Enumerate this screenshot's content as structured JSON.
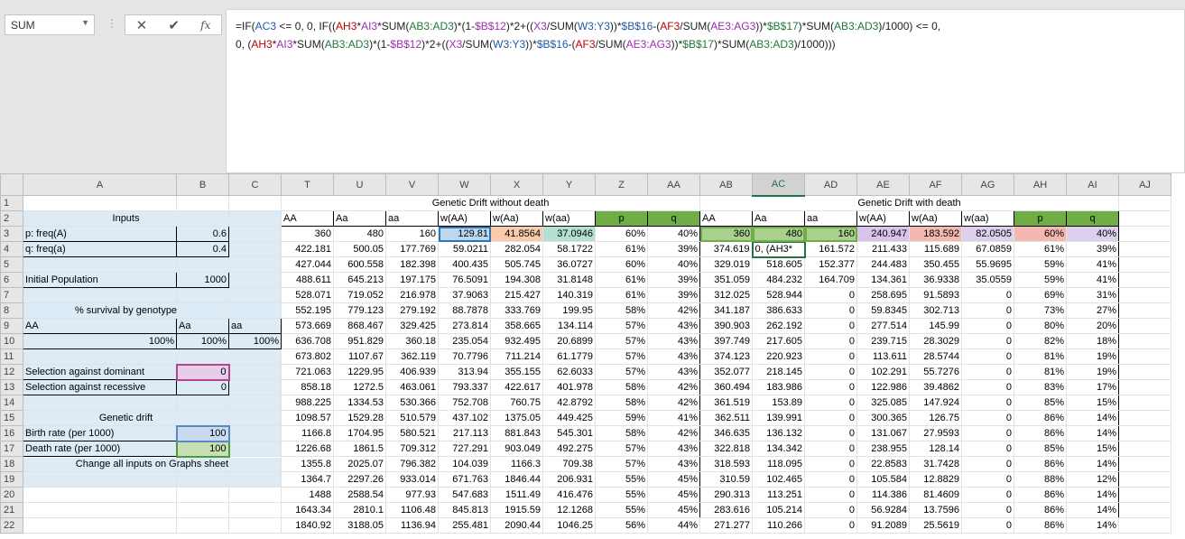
{
  "formula_bar": {
    "name_box": "SUM",
    "cancel_icon": "✕",
    "enter_icon": "✔",
    "fx_label": "fx",
    "line1_parts": [
      "=IF(",
      "AC3",
      " <= 0, 0, IF((",
      "AH3",
      "*",
      "AI3",
      "*SUM(",
      "AB3:AD3",
      ")*(1-",
      "$B$12",
      ")*2+((",
      "X3",
      "/SUM(",
      "W3:Y3",
      "))*",
      "$B$16",
      "-(",
      "AF3",
      "/SUM(",
      "AE3:AG3",
      "))*",
      "$B$17",
      ")*SUM(",
      "AB3:AD3",
      ")/1000) <= 0,"
    ],
    "line2_parts": [
      "0, (",
      "AH3",
      "*",
      "AI3",
      "*SUM(",
      "AB3:AD3",
      ")*(1-",
      "$B$12",
      ")*2+((",
      "X3",
      "/SUM(",
      "W3:Y3",
      "))*",
      "$B$16",
      "-(",
      "AF3",
      "/SUM(",
      "AE3:AG3",
      "))*",
      "$B$17",
      ")*SUM(",
      "AB3:AD3",
      ")/1000)))"
    ]
  },
  "columns": [
    "A",
    "B",
    "C",
    "T",
    "U",
    "V",
    "W",
    "X",
    "Y",
    "Z",
    "AA",
    "AB",
    "AC",
    "AD",
    "AE",
    "AF",
    "AG",
    "AH",
    "AI",
    "AJ"
  ],
  "selected_column": "AC",
  "inputs": {
    "title": "Inputs",
    "p_label": "p: freq(A)",
    "p_value": "0.6",
    "q_label": "q: freq(a)",
    "q_value": "0.4",
    "pop_label": "Initial Population",
    "pop_value": "1000",
    "survival_title": "% survival by genotype",
    "aa_dom_label": "AA",
    "aa_het_label": "Aa",
    "aa_rec_label": "aa",
    "surv_AA": "100%",
    "surv_Aa": "100%",
    "surv_aa": "100%",
    "sel_dom_label": "Selection against dominant",
    "sel_dom_value": "0",
    "sel_rec_label": "Selection against recessive",
    "sel_rec_value": "0",
    "drift_title": "Genetic drift",
    "birth_label": "Birth rate (per 1000)",
    "birth_value": "100",
    "death_label": "Death rate (per 1000)",
    "death_value": "100",
    "change_note": "Change all inputs on Graphs sheet"
  },
  "section_titles": {
    "without_death": "Genetic Drift without death",
    "with_death": "Genetic Drift with death"
  },
  "headers_without": [
    "AA",
    "Aa",
    "aa",
    "w(AA)",
    "w(Aa)",
    "w(aa)",
    "p",
    "q"
  ],
  "headers_with": [
    "AA",
    "Aa",
    "aa",
    "w(AA)",
    "w(Aa)",
    "w(aa)",
    "p",
    "q"
  ],
  "editing_text": "0, (AH3*",
  "rows_data": [
    [
      "360",
      "480",
      "160",
      "129.81",
      "41.8564",
      "37.0946",
      "60%",
      "40%",
      "360",
      "480",
      "160",
      "240.947",
      "183.592",
      "82.0505",
      "60%",
      "40%"
    ],
    [
      "422.181",
      "500.05",
      "177.769",
      "59.0211",
      "282.054",
      "58.1722",
      "61%",
      "39%",
      "374.619",
      "",
      "161.572",
      "211.433",
      "115.689",
      "67.0859",
      "61%",
      "39%"
    ],
    [
      "427.044",
      "600.558",
      "182.398",
      "400.435",
      "505.745",
      "36.0727",
      "60%",
      "40%",
      "329.019",
      "518.605",
      "152.377",
      "244.483",
      "350.455",
      "55.9695",
      "59%",
      "41%"
    ],
    [
      "488.611",
      "645.213",
      "197.175",
      "76.5091",
      "194.308",
      "31.8148",
      "61%",
      "39%",
      "351.059",
      "484.232",
      "164.709",
      "134.361",
      "36.9338",
      "35.0559",
      "59%",
      "41%"
    ],
    [
      "528.071",
      "719.052",
      "216.978",
      "37.9063",
      "215.427",
      "140.319",
      "61%",
      "39%",
      "312.025",
      "528.944",
      "0",
      "258.695",
      "91.5893",
      "0",
      "69%",
      "31%"
    ],
    [
      "552.195",
      "779.123",
      "279.192",
      "88.7878",
      "333.769",
      "199.95",
      "58%",
      "42%",
      "341.187",
      "386.633",
      "0",
      "59.8345",
      "302.713",
      "0",
      "73%",
      "27%"
    ],
    [
      "573.669",
      "868.467",
      "329.425",
      "273.814",
      "358.665",
      "134.114",
      "57%",
      "43%",
      "390.903",
      "262.192",
      "0",
      "277.514",
      "145.99",
      "0",
      "80%",
      "20%"
    ],
    [
      "636.708",
      "951.829",
      "360.18",
      "235.054",
      "932.495",
      "20.6899",
      "57%",
      "43%",
      "397.749",
      "217.605",
      "0",
      "239.715",
      "28.3029",
      "0",
      "82%",
      "18%"
    ],
    [
      "673.802",
      "1107.67",
      "362.119",
      "70.7796",
      "711.214",
      "61.1779",
      "57%",
      "43%",
      "374.123",
      "220.923",
      "0",
      "113.611",
      "28.5744",
      "0",
      "81%",
      "19%"
    ],
    [
      "721.063",
      "1229.95",
      "406.939",
      "313.94",
      "355.155",
      "62.6033",
      "57%",
      "43%",
      "352.077",
      "218.145",
      "0",
      "102.291",
      "55.7276",
      "0",
      "81%",
      "19%"
    ],
    [
      "858.18",
      "1272.5",
      "463.061",
      "793.337",
      "422.617",
      "401.978",
      "58%",
      "42%",
      "360.494",
      "183.986",
      "0",
      "122.986",
      "39.4862",
      "0",
      "83%",
      "17%"
    ],
    [
      "988.225",
      "1334.53",
      "530.366",
      "752.708",
      "760.75",
      "42.8792",
      "58%",
      "42%",
      "361.519",
      "153.89",
      "0",
      "325.085",
      "147.924",
      "0",
      "85%",
      "15%"
    ],
    [
      "1098.57",
      "1529.28",
      "510.579",
      "437.102",
      "1375.05",
      "449.425",
      "59%",
      "41%",
      "362.511",
      "139.991",
      "0",
      "300.365",
      "126.75",
      "0",
      "86%",
      "14%"
    ],
    [
      "1166.8",
      "1704.95",
      "580.521",
      "217.113",
      "881.843",
      "545.301",
      "58%",
      "42%",
      "346.635",
      "136.132",
      "0",
      "131.067",
      "27.9593",
      "0",
      "86%",
      "14%"
    ],
    [
      "1226.68",
      "1861.5",
      "709.312",
      "727.291",
      "903.049",
      "492.275",
      "57%",
      "43%",
      "322.818",
      "134.342",
      "0",
      "238.955",
      "128.14",
      "0",
      "85%",
      "15%"
    ],
    [
      "1355.8",
      "2025.07",
      "796.382",
      "104.039",
      "1166.3",
      "709.38",
      "57%",
      "43%",
      "318.593",
      "118.095",
      "0",
      "22.8583",
      "31.7428",
      "0",
      "86%",
      "14%"
    ],
    [
      "1364.7",
      "2297.26",
      "933.014",
      "671.763",
      "1846.44",
      "206.931",
      "55%",
      "45%",
      "310.59",
      "102.465",
      "0",
      "105.584",
      "12.8829",
      "0",
      "88%",
      "12%"
    ],
    [
      "1488",
      "2588.54",
      "977.93",
      "547.683",
      "1511.49",
      "416.476",
      "55%",
      "45%",
      "290.313",
      "113.251",
      "0",
      "114.386",
      "81.4609",
      "0",
      "86%",
      "14%"
    ],
    [
      "1643.34",
      "2810.1",
      "1106.48",
      "845.813",
      "1915.59",
      "12.1268",
      "55%",
      "45%",
      "283.616",
      "105.214",
      "0",
      "56.9284",
      "13.7596",
      "0",
      "86%",
      "14%"
    ]
  ],
  "partial_row": [
    "1840.92",
    "3188.05",
    "1136.94",
    "255.481",
    "2090.44",
    "1046.25",
    "56%",
    "44%",
    "271.277",
    "110.266",
    "0",
    "91.2089",
    "25.5619",
    "0",
    "86%",
    "14%"
  ]
}
